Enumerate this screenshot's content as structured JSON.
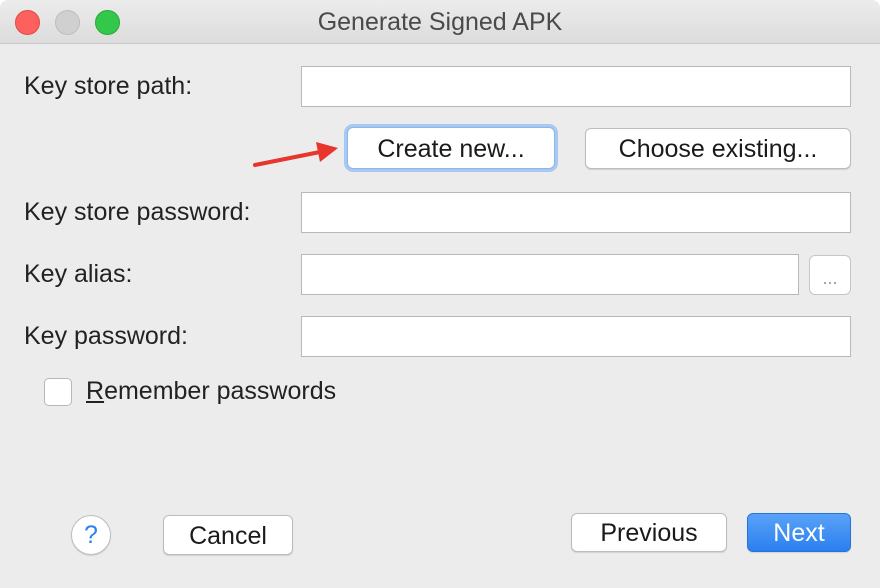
{
  "window": {
    "title": "Generate Signed APK"
  },
  "form": {
    "key_store_path_label": "Key store path:",
    "key_store_path_value": "",
    "create_new_label": "Create new...",
    "choose_existing_label": "Choose existing...",
    "key_store_password_label": "Key store password:",
    "key_store_password_value": "",
    "key_alias_label": "Key alias:",
    "key_alias_value": "",
    "key_alias_browse_label": "...",
    "key_password_label": "Key password:",
    "key_password_value": "",
    "remember_first_letter": "R",
    "remember_rest": "emember passwords",
    "remember_checked": false
  },
  "footer": {
    "help_label": "?",
    "cancel_label": "Cancel",
    "previous_label": "Previous",
    "next_label": "Next"
  },
  "annotation": {
    "arrow_color": "#e8362c"
  },
  "colors": {
    "accent": "#2a7ff0",
    "focus_ring": "#a7c8f2",
    "close": "#fc615d",
    "zoom": "#34c84a"
  }
}
